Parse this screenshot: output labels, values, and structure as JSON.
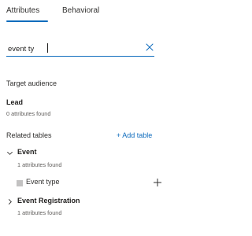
{
  "tabs": [
    {
      "label": "Attributes",
      "active": true
    },
    {
      "label": "Behavioral",
      "active": false
    }
  ],
  "search": {
    "value": "event ty",
    "clear_icon": "close-icon"
  },
  "target_audience": {
    "title": "Target audience",
    "entity": "Lead",
    "count_text": "0 attributes found"
  },
  "related_tables": {
    "title": "Related tables",
    "add_label": "+ Add table",
    "tables": [
      {
        "name": "Event",
        "count_text": "1 attributes found",
        "expanded": true,
        "expand_icon": "chevron-down-icon",
        "attributes": [
          {
            "label": "Event type",
            "icon": "list-icon",
            "action_icon": "plus-icon"
          }
        ]
      },
      {
        "name": "Event Registration",
        "count_text": "1 attributes found",
        "expanded": false,
        "expand_icon": "chevron-right-icon"
      }
    ]
  },
  "colors": {
    "accent": "#0f6cbd",
    "text": "#201f1e",
    "secondary_text": "#605e5c"
  }
}
